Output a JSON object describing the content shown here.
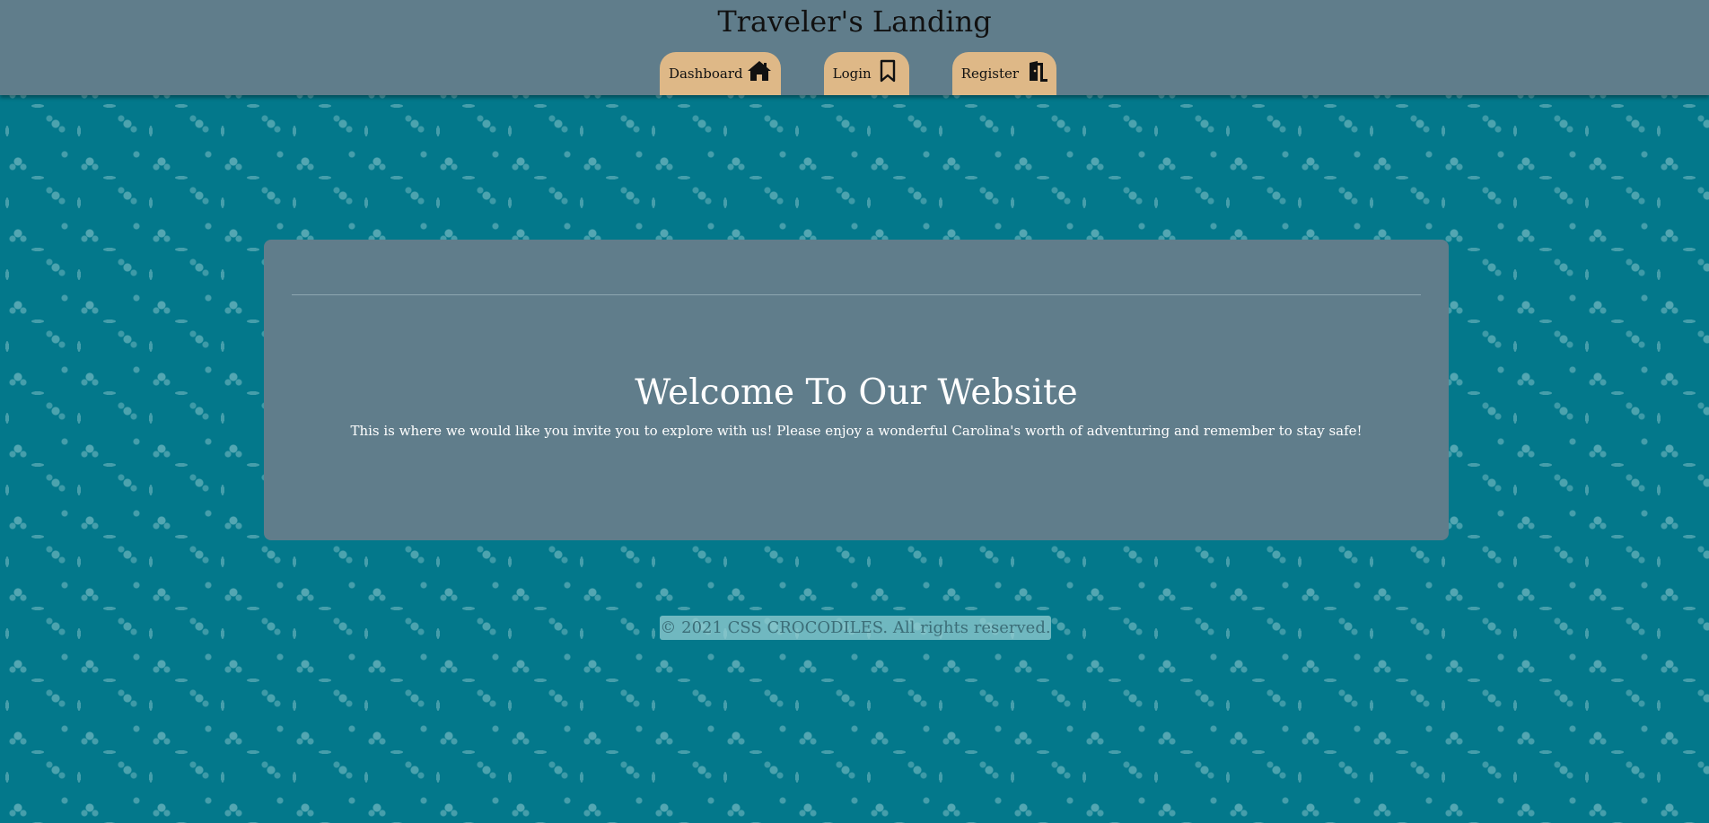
{
  "header": {
    "title": "Traveler's Landing",
    "nav": [
      {
        "label": "Dashboard",
        "icon": "home-icon"
      },
      {
        "label": "Login",
        "icon": "bookmark-icon"
      },
      {
        "label": "Register",
        "icon": "door-open-icon"
      }
    ]
  },
  "main": {
    "welcome_title": "Welcome To Our Website",
    "welcome_text": "This is where we would like you invite you to explore with us! Please enjoy a wonderful Carolina's worth of adventuring and remember to stay safe!"
  },
  "footer": {
    "copyright": "© 2021 CSS CROCODILES. All rights reserved."
  },
  "colors": {
    "header_bg": "#607d8b",
    "tab_bg": "#deb887",
    "page_bg": "#03788b",
    "card_bg": "#607d8b"
  }
}
